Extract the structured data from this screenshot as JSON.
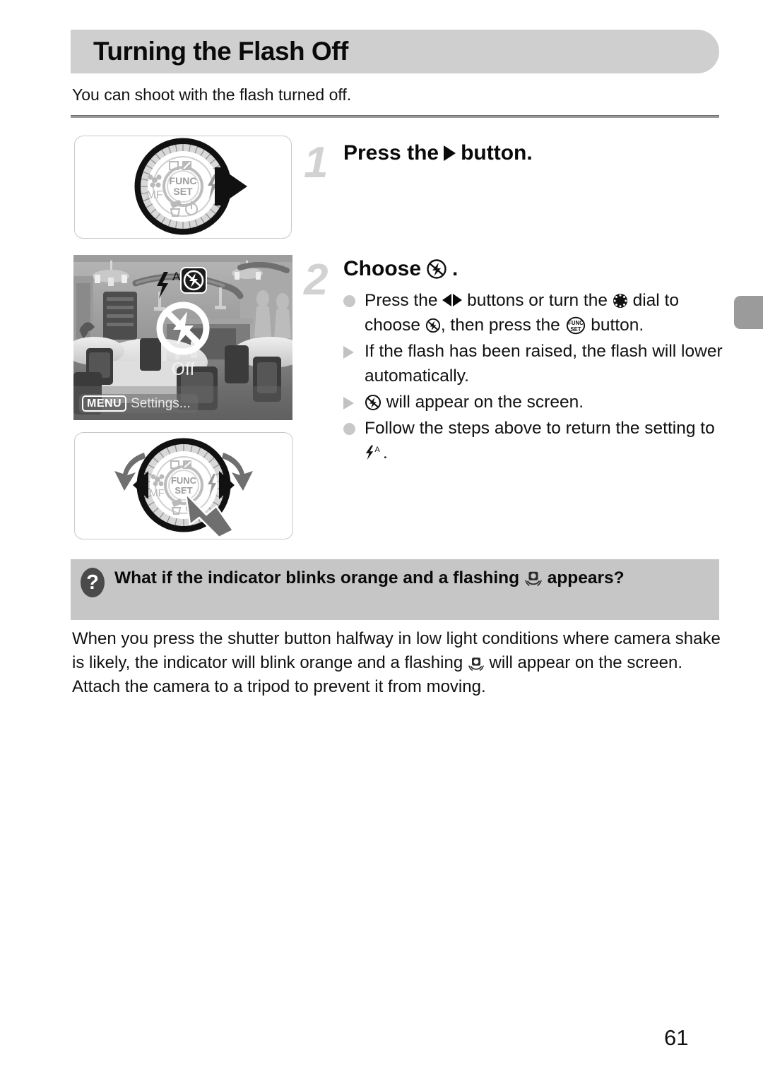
{
  "page": {
    "title": "Turning the Flash Off",
    "intro": "You can shoot with the flash turned off.",
    "number": "61"
  },
  "steps": [
    {
      "number": "1",
      "title_before": "Press the",
      "icon": "right-arrow-button-icon",
      "title_after": "button."
    },
    {
      "number": "2",
      "title_before": "Choose",
      "icon": "flash-off-icon",
      "title_after": ".",
      "bullets": [
        {
          "marker": "dot",
          "segments": [
            {
              "type": "text",
              "value": "Press the "
            },
            {
              "type": "icon",
              "value": "left-arrow-button-icon"
            },
            {
              "type": "icon",
              "value": "right-arrow-button-icon"
            },
            {
              "type": "text",
              "value": " buttons or turn the "
            },
            {
              "type": "icon",
              "value": "control-dial-icon"
            },
            {
              "type": "text",
              "value": " dial to choose "
            },
            {
              "type": "icon",
              "value": "flash-off-icon"
            },
            {
              "type": "text",
              "value": ", then press the "
            },
            {
              "type": "icon",
              "value": "func-set-button-icon"
            },
            {
              "type": "text",
              "value": " button."
            }
          ]
        },
        {
          "marker": "triangle",
          "segments": [
            {
              "type": "text",
              "value": "If the flash has been raised, the flash will lower automatically."
            }
          ]
        },
        {
          "marker": "triangle",
          "segments": [
            {
              "type": "icon",
              "value": "flash-off-icon"
            },
            {
              "type": "text",
              "value": " will appear on the screen."
            }
          ]
        },
        {
          "marker": "dot",
          "segments": [
            {
              "type": "text",
              "value": "Follow the steps above to return the setting to "
            },
            {
              "type": "icon",
              "value": "flash-auto-icon"
            },
            {
              "type": "text",
              "value": "."
            }
          ]
        }
      ]
    }
  ],
  "figures": {
    "dial_1": {
      "name": "camera-control-dial-press-right",
      "labels": {
        "center_top": "FUNC",
        "center_bottom": "SET",
        "macro_mf": "MF"
      }
    },
    "dial_2": {
      "name": "camera-control-dial-turn-and-press",
      "labels": {
        "center_top": "FUNC",
        "center_bottom": "SET",
        "macro_mf": "MF"
      }
    },
    "photo": {
      "name": "camera-screen-flash-off-selection",
      "status_label": "Off",
      "menu_badge": "MENU",
      "menu_label": "Settings...",
      "options": [
        "flash-auto-icon",
        "flash-off-icon"
      ],
      "selected_option": "flash-off-icon"
    }
  },
  "callout": {
    "icon": "question-mark-icon",
    "text_before": "What if the indicator blinks orange and a flashing ",
    "icon_inline": "camera-shake-icon",
    "text_after": " appears?"
  },
  "body": {
    "part1": "When you press the shutter button halfway in low light conditions where camera shake is likely, the indicator will blink orange and a flashing ",
    "icon_inline": "camera-shake-icon",
    "part2": " will appear on the screen. Attach the camera to a tripod to prevent it from moving."
  },
  "colors": {
    "header_bg": "#cfcfcf",
    "callout_bg": "#c6c6c6",
    "step_number": "#d2d2d2",
    "bullet_dot": "#c8c8c8",
    "edge_tab": "#9b9b9b"
  }
}
